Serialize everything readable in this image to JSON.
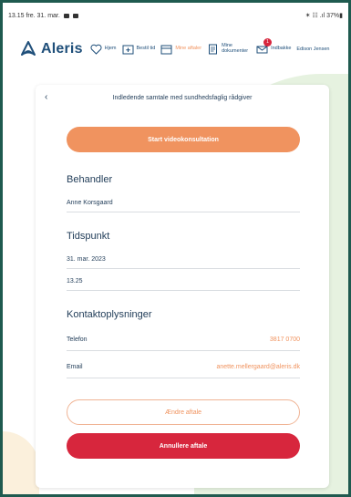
{
  "status_bar": {
    "time_date": "13.15  fre. 31. mar.",
    "right": "✶ ☷ .ıl 37%▮"
  },
  "nav": {
    "logo_text": "Aleris",
    "items": [
      {
        "label": "Hjem",
        "icon": "heart-icon"
      },
      {
        "label": "Bestil tid",
        "icon": "calendar-plus-icon"
      },
      {
        "label": "Mine aftaler",
        "icon": "calendar-icon",
        "active": true
      },
      {
        "label": "Mine dokumenter",
        "icon": "document-icon"
      },
      {
        "label": "Indbakke",
        "icon": "mail-icon",
        "badge": "1"
      }
    ],
    "user": "Edison Jensen"
  },
  "card": {
    "title": "Indledende samtale med sundhedsfaglig rådgiver",
    "video_button": "Start videokonsultation",
    "behandler_title": "Behandler",
    "behandler_value": "Anne Korsgaard",
    "tidspunkt_title": "Tidspunkt",
    "date_value": "31. mar. 2023",
    "time_value": "13.25",
    "kontakt_title": "Kontaktoplysninger",
    "telefon_label": "Telefon",
    "telefon_value": "3817 0700",
    "email_label": "Email",
    "email_value": "anette.mellergaard@aleris.dk",
    "change_button": "Ændre aftale",
    "cancel_button": "Annullere aftale"
  },
  "colors": {
    "accent": "#f0935f",
    "danger": "#d7263d",
    "brand": "#1f4f7a"
  }
}
